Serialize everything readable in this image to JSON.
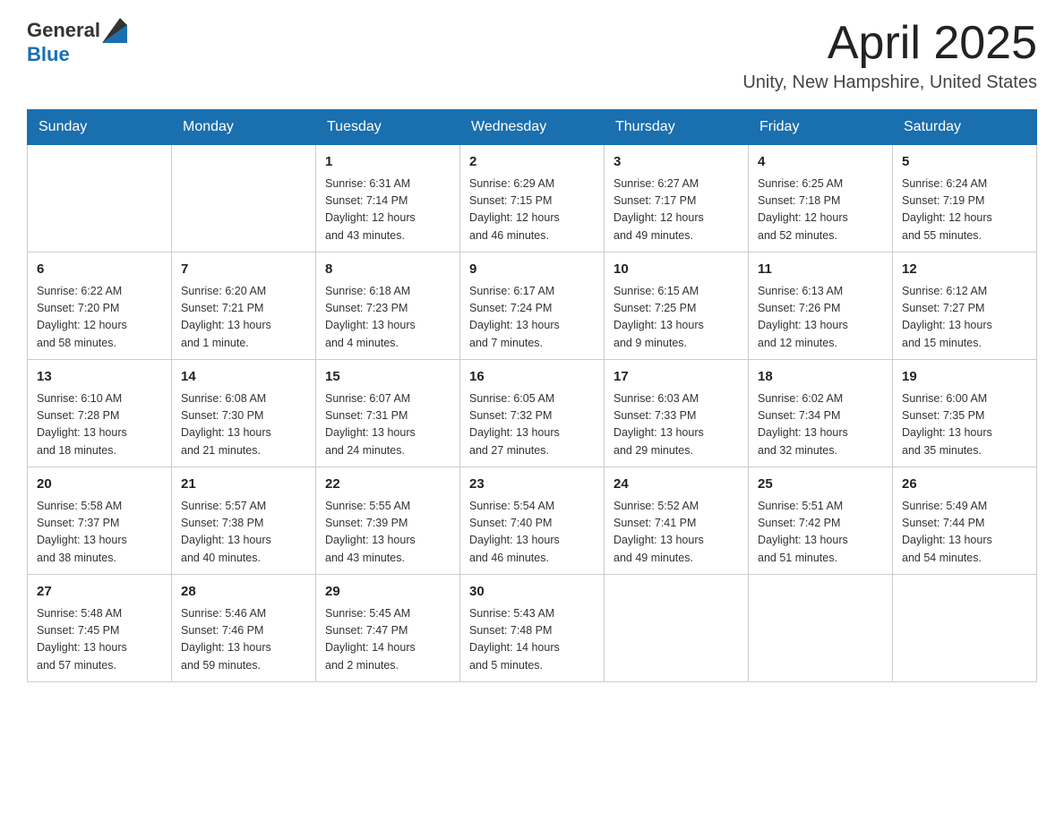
{
  "header": {
    "logo_general": "General",
    "logo_blue": "Blue",
    "month_year": "April 2025",
    "location": "Unity, New Hampshire, United States"
  },
  "days_of_week": [
    "Sunday",
    "Monday",
    "Tuesday",
    "Wednesday",
    "Thursday",
    "Friday",
    "Saturday"
  ],
  "weeks": [
    [
      {
        "day": "",
        "info": ""
      },
      {
        "day": "",
        "info": ""
      },
      {
        "day": "1",
        "info": "Sunrise: 6:31 AM\nSunset: 7:14 PM\nDaylight: 12 hours\nand 43 minutes."
      },
      {
        "day": "2",
        "info": "Sunrise: 6:29 AM\nSunset: 7:15 PM\nDaylight: 12 hours\nand 46 minutes."
      },
      {
        "day": "3",
        "info": "Sunrise: 6:27 AM\nSunset: 7:17 PM\nDaylight: 12 hours\nand 49 minutes."
      },
      {
        "day": "4",
        "info": "Sunrise: 6:25 AM\nSunset: 7:18 PM\nDaylight: 12 hours\nand 52 minutes."
      },
      {
        "day": "5",
        "info": "Sunrise: 6:24 AM\nSunset: 7:19 PM\nDaylight: 12 hours\nand 55 minutes."
      }
    ],
    [
      {
        "day": "6",
        "info": "Sunrise: 6:22 AM\nSunset: 7:20 PM\nDaylight: 12 hours\nand 58 minutes."
      },
      {
        "day": "7",
        "info": "Sunrise: 6:20 AM\nSunset: 7:21 PM\nDaylight: 13 hours\nand 1 minute."
      },
      {
        "day": "8",
        "info": "Sunrise: 6:18 AM\nSunset: 7:23 PM\nDaylight: 13 hours\nand 4 minutes."
      },
      {
        "day": "9",
        "info": "Sunrise: 6:17 AM\nSunset: 7:24 PM\nDaylight: 13 hours\nand 7 minutes."
      },
      {
        "day": "10",
        "info": "Sunrise: 6:15 AM\nSunset: 7:25 PM\nDaylight: 13 hours\nand 9 minutes."
      },
      {
        "day": "11",
        "info": "Sunrise: 6:13 AM\nSunset: 7:26 PM\nDaylight: 13 hours\nand 12 minutes."
      },
      {
        "day": "12",
        "info": "Sunrise: 6:12 AM\nSunset: 7:27 PM\nDaylight: 13 hours\nand 15 minutes."
      }
    ],
    [
      {
        "day": "13",
        "info": "Sunrise: 6:10 AM\nSunset: 7:28 PM\nDaylight: 13 hours\nand 18 minutes."
      },
      {
        "day": "14",
        "info": "Sunrise: 6:08 AM\nSunset: 7:30 PM\nDaylight: 13 hours\nand 21 minutes."
      },
      {
        "day": "15",
        "info": "Sunrise: 6:07 AM\nSunset: 7:31 PM\nDaylight: 13 hours\nand 24 minutes."
      },
      {
        "day": "16",
        "info": "Sunrise: 6:05 AM\nSunset: 7:32 PM\nDaylight: 13 hours\nand 27 minutes."
      },
      {
        "day": "17",
        "info": "Sunrise: 6:03 AM\nSunset: 7:33 PM\nDaylight: 13 hours\nand 29 minutes."
      },
      {
        "day": "18",
        "info": "Sunrise: 6:02 AM\nSunset: 7:34 PM\nDaylight: 13 hours\nand 32 minutes."
      },
      {
        "day": "19",
        "info": "Sunrise: 6:00 AM\nSunset: 7:35 PM\nDaylight: 13 hours\nand 35 minutes."
      }
    ],
    [
      {
        "day": "20",
        "info": "Sunrise: 5:58 AM\nSunset: 7:37 PM\nDaylight: 13 hours\nand 38 minutes."
      },
      {
        "day": "21",
        "info": "Sunrise: 5:57 AM\nSunset: 7:38 PM\nDaylight: 13 hours\nand 40 minutes."
      },
      {
        "day": "22",
        "info": "Sunrise: 5:55 AM\nSunset: 7:39 PM\nDaylight: 13 hours\nand 43 minutes."
      },
      {
        "day": "23",
        "info": "Sunrise: 5:54 AM\nSunset: 7:40 PM\nDaylight: 13 hours\nand 46 minutes."
      },
      {
        "day": "24",
        "info": "Sunrise: 5:52 AM\nSunset: 7:41 PM\nDaylight: 13 hours\nand 49 minutes."
      },
      {
        "day": "25",
        "info": "Sunrise: 5:51 AM\nSunset: 7:42 PM\nDaylight: 13 hours\nand 51 minutes."
      },
      {
        "day": "26",
        "info": "Sunrise: 5:49 AM\nSunset: 7:44 PM\nDaylight: 13 hours\nand 54 minutes."
      }
    ],
    [
      {
        "day": "27",
        "info": "Sunrise: 5:48 AM\nSunset: 7:45 PM\nDaylight: 13 hours\nand 57 minutes."
      },
      {
        "day": "28",
        "info": "Sunrise: 5:46 AM\nSunset: 7:46 PM\nDaylight: 13 hours\nand 59 minutes."
      },
      {
        "day": "29",
        "info": "Sunrise: 5:45 AM\nSunset: 7:47 PM\nDaylight: 14 hours\nand 2 minutes."
      },
      {
        "day": "30",
        "info": "Sunrise: 5:43 AM\nSunset: 7:48 PM\nDaylight: 14 hours\nand 5 minutes."
      },
      {
        "day": "",
        "info": ""
      },
      {
        "day": "",
        "info": ""
      },
      {
        "day": "",
        "info": ""
      }
    ]
  ]
}
